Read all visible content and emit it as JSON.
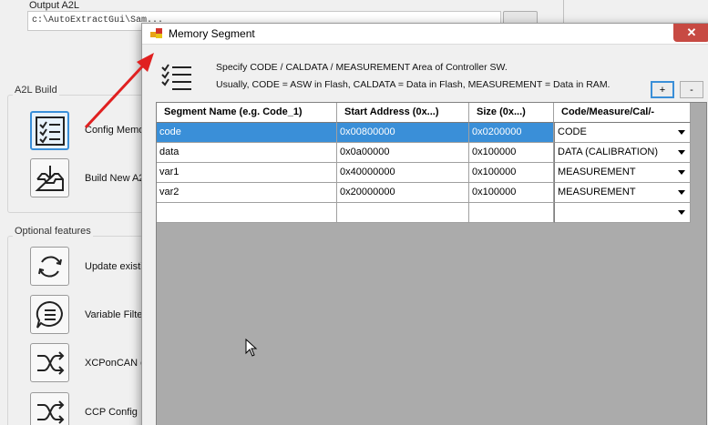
{
  "main": {
    "output_label": "Output A2L",
    "output_path": "c:\\AutoExtractGui\\Sam...",
    "a2l_build_label": "A2L Build",
    "optional_label": "Optional features",
    "buttons": [
      {
        "label": "Config Memo",
        "icon": "checklist-icon"
      },
      {
        "label": "Build New A2",
        "icon": "inbox-download-icon"
      },
      {
        "label": "Update existi",
        "icon": "refresh-icon"
      },
      {
        "label": "Variable Filter",
        "icon": "list-bubble-icon"
      },
      {
        "label": "XCPonCAN c",
        "icon": "shuffle-icon"
      },
      {
        "label": "CCP Config",
        "icon": "shuffle-icon"
      }
    ]
  },
  "dialog": {
    "title": "Memory Segment",
    "close_glyph": "✕",
    "desc_line1": "Specify CODE / CALDATA / MEASUREMENT Area of Controller SW.",
    "desc_line2": "Usually, CODE = ASW in Flash, CALDATA = Data in Flash, MEASUREMENT = Data in RAM.",
    "add_label": "+",
    "remove_label": "-",
    "columns": [
      "Segment Name (e.g. Code_1)",
      "Start Address (0x...)",
      "Size (0x...)",
      "Code/Measure/Cal/-"
    ],
    "rows": [
      {
        "name": "code",
        "start": "0x00800000",
        "size": "0x0200000",
        "type": "CODE"
      },
      {
        "name": "data",
        "start": "0x0a00000",
        "size": "0x100000",
        "type": "DATA (CALIBRATION)"
      },
      {
        "name": "var1",
        "start": "0x40000000",
        "size": "0x100000",
        "type": "MEASUREMENT"
      },
      {
        "name": "var2",
        "start": "0x20000000",
        "size": "0x100000",
        "type": "MEASUREMENT"
      },
      {
        "name": "",
        "start": "",
        "size": "",
        "type": ""
      }
    ]
  },
  "colors": {
    "selection": "#3a8fd8",
    "close": "#c74a43",
    "arrow": "#e02020"
  }
}
